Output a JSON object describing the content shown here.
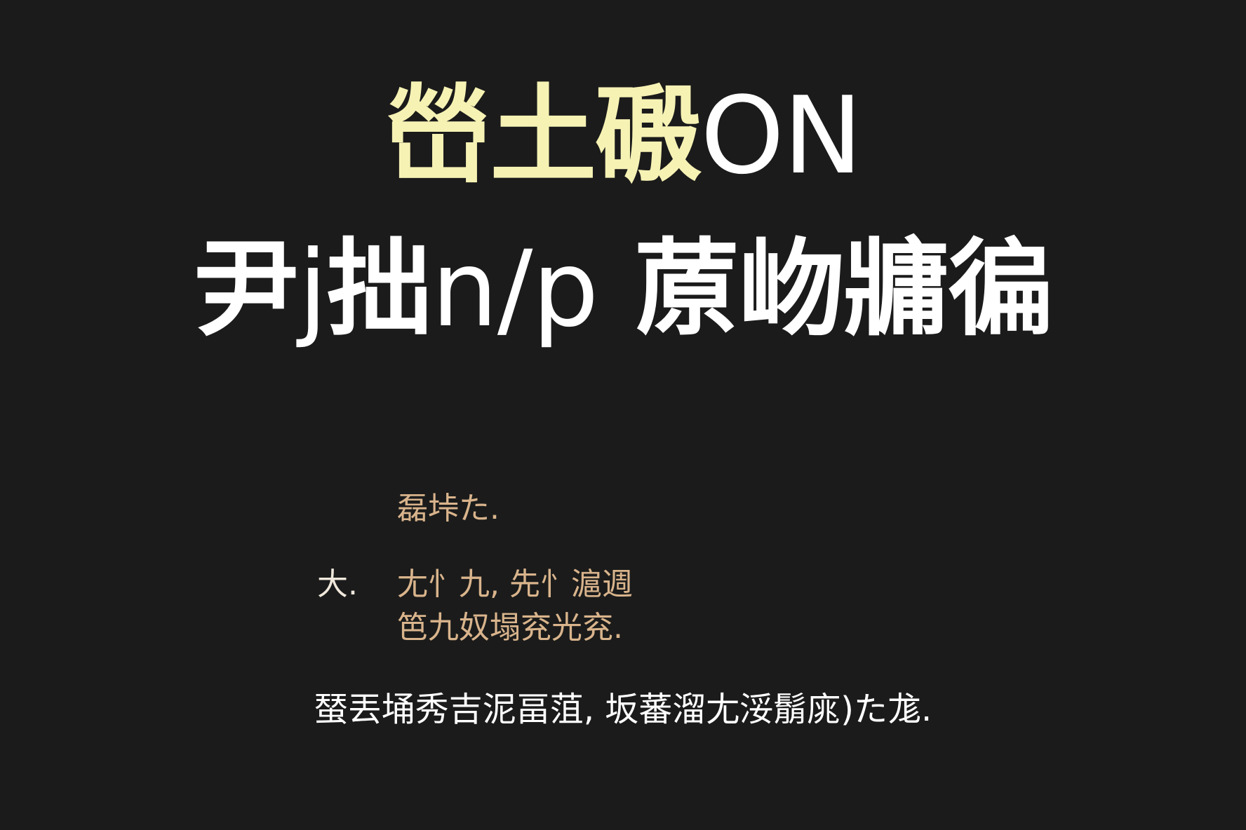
{
  "colors": {
    "background": "#1b1b1b",
    "title_accent": "#f6f2b4",
    "title_plain": "#ffffff",
    "note": "#d9b48c",
    "footer": "#ffffff"
  },
  "title": {
    "line1_accent": "嵤土磤",
    "line1_plain": "ON",
    "line2_a": "尹",
    "line2_b": "j",
    "line2_c": "拙",
    "line2_d": "n/p",
    "line2_e": " 蒝岉牅",
    "line2_f": "徧"
  },
  "notes": {
    "line1": "磊垰た.",
    "bullet": "大.",
    "line2": "尢忄九, 先忄滬週",
    "line3": "笆九奴塌兖光兖."
  },
  "footer": "蝅丟埇秀吉泥畐菹, 坂蕃溜尢浽鬅庣)た尨."
}
